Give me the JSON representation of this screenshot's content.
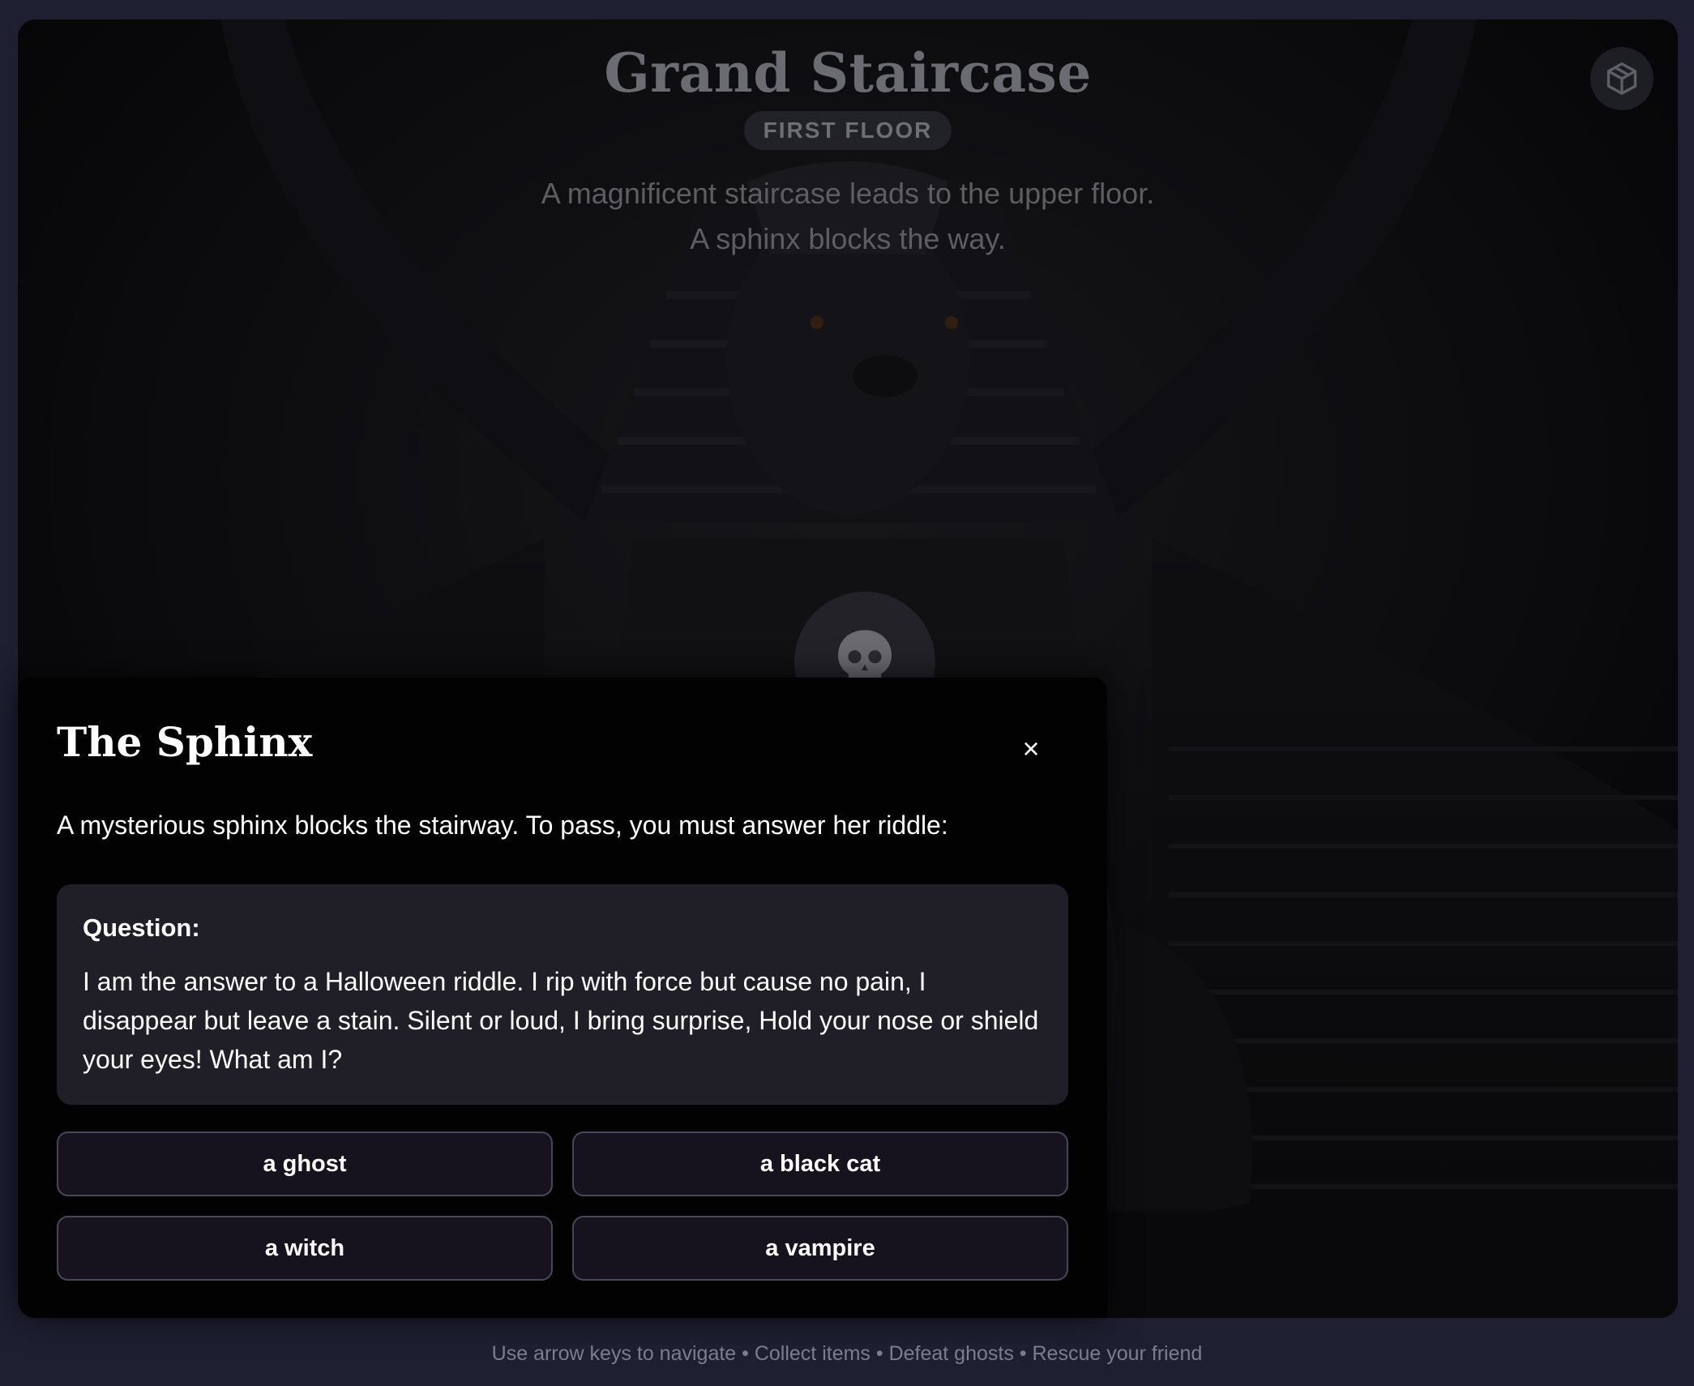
{
  "room": {
    "title": "Grand Staircase",
    "floor": "FIRST FLOOR",
    "description_line1": "A magnificent staircase leads to the upper floor.",
    "description_line2": "A sphinx blocks the way."
  },
  "icons": {
    "inventory": "cube-icon",
    "enemy": "skull-icon",
    "close": "close-icon"
  },
  "dialog": {
    "title": "The Sphinx",
    "close_symbol": "×",
    "intro": "A mysterious sphinx blocks the stairway. To pass, you must answer her riddle:",
    "question_label": "Question:",
    "question": "I am the answer to a Halloween riddle. I rip with force but cause no pain, I disappear but leave a stain. Silent or loud, I bring surprise, Hold your nose or shield your eyes! What am I?",
    "answers": [
      "a ghost",
      "a black cat",
      "a witch",
      "a vampire"
    ]
  },
  "footer": {
    "hint": "Use arrow keys to navigate • Collect items • Defeat ghosts • Rescue your friend"
  },
  "colors": {
    "page_background": "#1e2032",
    "dialog_background": "#020203",
    "question_background": "#201f28",
    "answer_background": "#16131e",
    "answer_border": "#4a4858"
  }
}
